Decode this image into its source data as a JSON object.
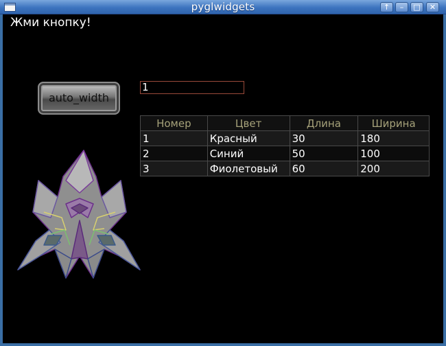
{
  "window": {
    "title": "pyglwidgets"
  },
  "prompt": {
    "text": "Жми кнопку!"
  },
  "auto_button": {
    "label": "auto_width"
  },
  "text_input": {
    "value": "1"
  },
  "table": {
    "headers": [
      "Номер",
      "Цвет",
      "Длина",
      "Ширина"
    ],
    "rows": [
      [
        "1",
        "Красный",
        "30",
        "180"
      ],
      [
        "2",
        "Синий",
        "50",
        "100"
      ],
      [
        "3",
        "Фиолетовый",
        "60",
        "200"
      ]
    ]
  },
  "colors": {
    "background": "#000000",
    "header_text": "#a6a27a",
    "titlebar": "#3d74bf"
  }
}
